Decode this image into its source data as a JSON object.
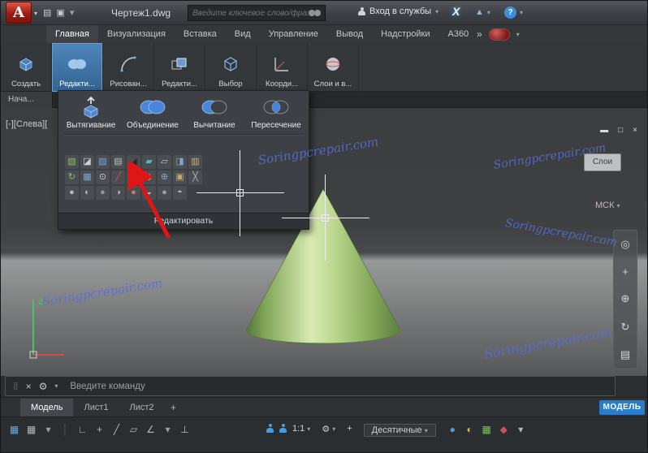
{
  "titlebar": {
    "app_letter": "A",
    "chevron": "▾",
    "qat": [
      {
        "name": "open-file-icon",
        "glyph": "▤",
        "color": "#c8ccd0"
      },
      {
        "name": "plot-icon",
        "glyph": "▣",
        "color": "#c8ccd0"
      },
      {
        "name": "chevron-down-icon",
        "glyph": "▾",
        "color": "#9aa0a6"
      }
    ],
    "title": "Чертеж1.dwg",
    "search_placeholder": "Введите ключевое слово/фразу",
    "signin_label": "Вход в службы",
    "exchange_label": "X",
    "share_glyph": "▲",
    "help_label": "?"
  },
  "ribbon_tabs": {
    "tabs": [
      {
        "label": "Главная",
        "active": true
      },
      {
        "label": "Визуализация"
      },
      {
        "label": "Вставка"
      },
      {
        "label": "Вид"
      },
      {
        "label": "Управление"
      },
      {
        "label": "Вывод"
      },
      {
        "label": "Надстройки"
      },
      {
        "label": "A360"
      }
    ],
    "overflow": "»"
  },
  "ribbon_panels": {
    "panels": [
      {
        "label": "Создать"
      },
      {
        "label": "Редакти...",
        "active": true
      },
      {
        "label": "Рисован..."
      },
      {
        "label": "Редакти..."
      },
      {
        "label": "Выбор"
      },
      {
        "label": "Коорди..."
      },
      {
        "label": "Слои и в..."
      }
    ]
  },
  "file_tabs": {
    "start_tab": "Нача..."
  },
  "dropdown": {
    "big_tools": [
      {
        "label": "Вытягивание"
      },
      {
        "label": "Объединение"
      },
      {
        "label": "Вычитание"
      },
      {
        "label": "Пересечение"
      }
    ],
    "row1": [
      {
        "name": "extrude-faces-icon",
        "glyph": "▧",
        "color": "#8fbf6a"
      },
      {
        "name": "move-faces-icon",
        "glyph": "◪",
        "color": "#cdd3d8"
      },
      {
        "name": "offset-faces-icon",
        "glyph": "▨",
        "color": "#7aa6d8"
      },
      {
        "name": "delete-faces-icon",
        "glyph": "▤",
        "color": "#b9bfc4"
      },
      {
        "name": "slice-icon",
        "glyph": "◢",
        "color": "#23262a"
      },
      {
        "name": "shell-icon",
        "glyph": "▰",
        "color": "#57b8b0"
      },
      {
        "name": "clean-icon",
        "glyph": "▱",
        "color": "#c0c6cc"
      },
      {
        "name": "separate-icon",
        "glyph": "◨",
        "color": "#7aa6d8"
      },
      {
        "name": "check-icon",
        "glyph": "▥",
        "color": "#c9b27c"
      }
    ],
    "row2": [
      {
        "name": "imprint-icon",
        "glyph": "↻",
        "color": "#8fbf6a"
      },
      {
        "name": "color-faces-icon",
        "glyph": "▦",
        "color": "#7aa6d8"
      },
      {
        "name": "copy-edges-icon",
        "glyph": "⊙",
        "color": "#c8cdd2"
      },
      {
        "name": "extract-edges-icon",
        "glyph": "╱",
        "color": "#d25454"
      },
      {
        "name": "fillet-edge-icon",
        "glyph": "▩",
        "color": "#9aa0a6"
      },
      {
        "name": "chamfer-edge-icon",
        "glyph": "◇",
        "color": "#c8cdd2"
      },
      {
        "name": "thicken-icon",
        "glyph": "⊕",
        "color": "#7aa6d8"
      },
      {
        "name": "interfere-icon",
        "glyph": "▣",
        "color": "#c9a868"
      },
      {
        "name": "convert-icon",
        "glyph": "╳",
        "color": "#b4b8bc"
      }
    ],
    "row3": [
      {
        "name": "sphere-tool-icon",
        "glyph": "●",
        "color": "#b2b8be"
      },
      {
        "name": "sphere-tool-icon",
        "glyph": "◐",
        "color": "#b2b8be"
      },
      {
        "name": "sphere-tool-icon",
        "glyph": "●",
        "color": "#8e949a"
      },
      {
        "name": "sphere-tool-icon",
        "glyph": "◑",
        "color": "#b2b8be"
      },
      {
        "name": "sphere-tool-icon",
        "glyph": "●",
        "color": "#c47a7a"
      },
      {
        "name": "sphere-tool-icon",
        "glyph": "◒",
        "color": "#b2b8be"
      },
      {
        "name": "sphere-tool-icon",
        "glyph": "●",
        "color": "#9aa0a6"
      },
      {
        "name": "sphere-tool-icon",
        "glyph": "◓",
        "color": "#b2b8be"
      }
    ],
    "footer": "Редактировать"
  },
  "viewport": {
    "label": "[-][Слева][",
    "minimize": "▬",
    "restore": "□",
    "close": "×",
    "layers_box": "Слои",
    "wcs_label": "МСК",
    "axis_z": "Z",
    "navbar": [
      {
        "name": "navigation-wheel-icon",
        "glyph": "◎"
      },
      {
        "name": "pan-icon",
        "glyph": "+"
      },
      {
        "name": "zoom-icon",
        "glyph": "⊕"
      },
      {
        "name": "orbit-icon",
        "glyph": "↻"
      },
      {
        "name": "showmotion-icon",
        "glyph": "▤"
      }
    ]
  },
  "watermark": {
    "text": "Soringpcrepair.com",
    "color": "#5a6ed8"
  },
  "command": {
    "grip": "⣿",
    "close": "×",
    "tool": "⚙",
    "chevron": "▾",
    "prompt": "Введите команду"
  },
  "layouts": {
    "tabs": [
      {
        "label": "Модель",
        "active": true
      },
      {
        "label": "Лист1"
      },
      {
        "label": "Лист2"
      }
    ],
    "add": "+",
    "model_badge": "МОДЕЛЬ"
  },
  "statusbar": {
    "left": [
      {
        "name": "grid-display-icon",
        "glyph": "▦",
        "color": "#6aa9e0"
      },
      {
        "name": "snap-mode-icon",
        "glyph": "▦",
        "color": "#b4b8bc"
      },
      {
        "name": "chevron-down-icon",
        "glyph": "▾",
        "color": "#9aa0a6"
      },
      {
        "name": "separator",
        "glyph": "│",
        "color": "#53575b"
      },
      {
        "name": "infer-constraints-icon",
        "glyph": "∟",
        "color": "#b4b8bc"
      },
      {
        "name": "dynamic-input-icon",
        "glyph": "+",
        "color": "#b4b8bc"
      },
      {
        "name": "ortho-mode-icon",
        "glyph": "╱",
        "color": "#b4b8bc"
      },
      {
        "name": "isodraft-icon",
        "glyph": "▱",
        "color": "#b4b8bc"
      },
      {
        "name": "osnap-icon",
        "glyph": "∠",
        "color": "#b4b8bc"
      },
      {
        "name": "chevron-down-icon",
        "glyph": "▾",
        "color": "#9aa0a6"
      },
      {
        "name": "otrack-icon",
        "glyph": "⊥",
        "color": "#b4b8bc"
      }
    ],
    "scale": "1:1",
    "gear": "⚙",
    "plus": "+",
    "units": "Десятичные",
    "chevron": "▾",
    "right": [
      {
        "name": "graphics-performance-icon",
        "glyph": "●",
        "color": "#4a9ede"
      },
      {
        "name": "isolate-objects-icon",
        "glyph": "◐",
        "color": "#d8c04a"
      },
      {
        "name": "trusted-paths-icon",
        "glyph": "▦",
        "color": "#7cc35c"
      },
      {
        "name": "notification-icon",
        "glyph": "◆",
        "color": "#d05050"
      },
      {
        "name": "customization-icon",
        "glyph": "▾",
        "color": "#b4b8bc"
      }
    ]
  }
}
